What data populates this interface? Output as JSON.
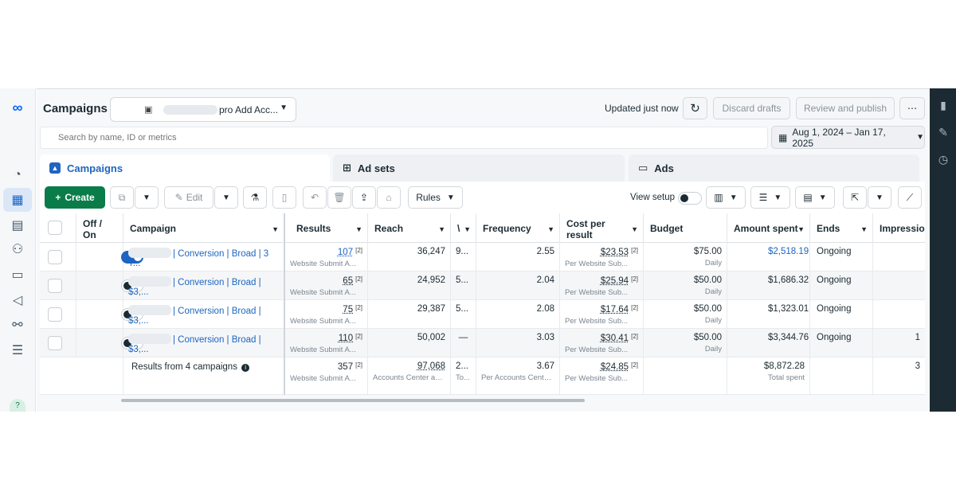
{
  "header": {
    "title": "Campaigns",
    "account_label": "pro Add Acc...",
    "updated": "Updated just now",
    "discard": "Discard drafts",
    "review": "Review and publish",
    "more": "⋯"
  },
  "search": {
    "placeholder": "Search by name, ID or metrics"
  },
  "date_range": "Aug 1, 2024 – Jan 17, 2025",
  "tabs": [
    {
      "label": "Campaigns",
      "active": true
    },
    {
      "label": "Ad sets",
      "active": false
    },
    {
      "label": "Ads",
      "active": false
    }
  ],
  "toolbar": {
    "create": "Create",
    "edit": "Edit",
    "rules": "Rules",
    "view_setup": "View setup"
  },
  "columns": [
    "Off / On",
    "Campaign",
    "Results",
    "Reach",
    "\\",
    "Frequency",
    "Cost per result",
    "Budget",
    "Amount spent",
    "Ends",
    "Impression"
  ],
  "rows": [
    {
      "on": true,
      "name": "| Conversion | Broad | 3 T...",
      "results": "107",
      "results_sub": "Website Submit A...",
      "reach": "36,247",
      "col5": "9...",
      "frequency": "2.55",
      "cpr": "$23.53",
      "cpr_sub": "Per Website Sub...",
      "budget": "$75.00",
      "budget_sub": "Daily",
      "spent": "$2,518.19",
      "ends": "Ongoing",
      "impr": ""
    },
    {
      "on": false,
      "name": "| Conversion | Broad | $3,...",
      "results": "65",
      "results_sub": "Website Submit A...",
      "reach": "24,952",
      "col5": "5...",
      "frequency": "2.04",
      "cpr": "$25.94",
      "cpr_sub": "Per Website Sub...",
      "budget": "$50.00",
      "budget_sub": "Daily",
      "spent": "$1,686.32",
      "ends": "Ongoing",
      "impr": ""
    },
    {
      "on": false,
      "name": "| Conversion | Broad | $3,...",
      "results": "75",
      "results_sub": "Website Submit A...",
      "reach": "29,387",
      "col5": "5...",
      "frequency": "2.08",
      "cpr": "$17.64",
      "cpr_sub": "Per Website Sub...",
      "budget": "$50.00",
      "budget_sub": "Daily",
      "spent": "$1,323.01",
      "ends": "Ongoing",
      "impr": ""
    },
    {
      "on": false,
      "name": "| Conversion | Broad | $3,...",
      "results": "110",
      "results_sub": "Website Submit A...",
      "reach": "50,002",
      "col5": "—",
      "frequency": "3.03",
      "cpr": "$30.41",
      "cpr_sub": "Per Website Sub...",
      "budget": "$50.00",
      "budget_sub": "Daily",
      "spent": "$3,344.76",
      "ends": "Ongoing",
      "impr": "1"
    }
  ],
  "totals": {
    "label": "Results from 4 campaigns",
    "results": "357",
    "results_sub": "Website Submit A...",
    "reach": "97,068",
    "reach_sub": "Accounts Center acc...",
    "col5": "2...",
    "col5_sub": "To...",
    "frequency": "3.67",
    "frequency_sub": "Per Accounts Center...",
    "cpr": "$24.85",
    "cpr_sub": "Per Website Sub...",
    "spent": "$8,872.28",
    "spent_sub": "Total spent",
    "impr": "3"
  },
  "colors": {
    "accent": "#1d65c1",
    "create": "#0a7c4a",
    "rail": "#1c2b33"
  },
  "icons": [
    "meta-logo",
    "gauge-icon",
    "table-icon",
    "pages-icon",
    "people-icon",
    "card-icon",
    "megaphone-icon",
    "network-icon",
    "menu-icon",
    "help-icon",
    "chart-icon",
    "pencil-icon",
    "clock-icon"
  ]
}
